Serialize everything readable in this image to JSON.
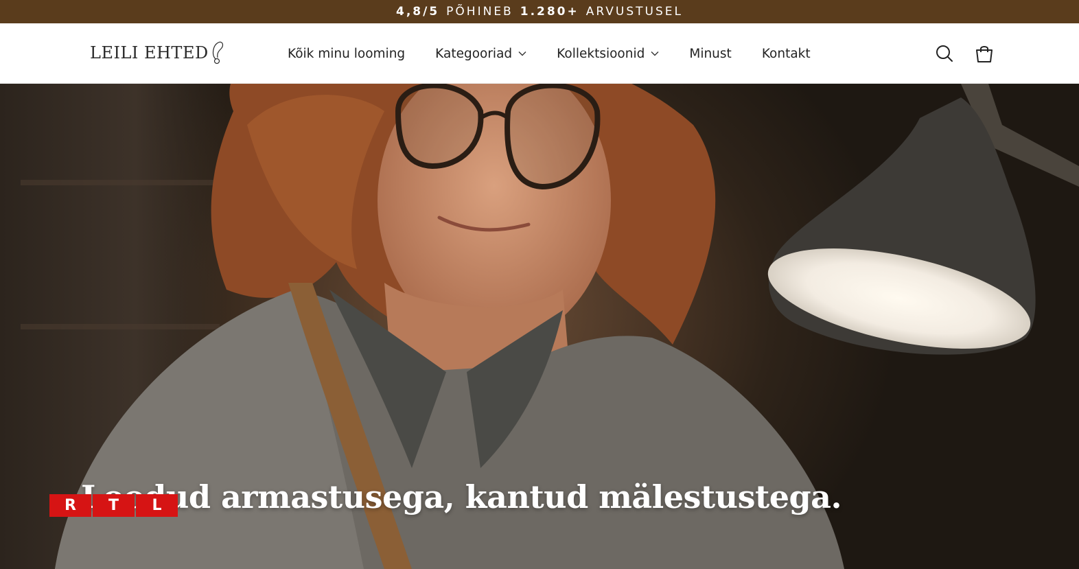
{
  "announcement": {
    "rating": "4,8/5",
    "based_on": "PÕHINEB",
    "count": "1.280+",
    "reviews": "ARVUSTUSEL"
  },
  "header": {
    "logo_text": "LEILI EHTED",
    "nav": [
      {
        "label": "Kõik minu looming",
        "has_dropdown": false
      },
      {
        "label": "Kategooriad",
        "has_dropdown": true
      },
      {
        "label": "Kollektsioonid",
        "has_dropdown": true
      },
      {
        "label": "Minust",
        "has_dropdown": false
      },
      {
        "label": "Kontakt",
        "has_dropdown": false
      }
    ],
    "icons": [
      "search-icon",
      "cart-icon"
    ]
  },
  "hero": {
    "heading": "Loodud armastusega, kantud mälestustega.",
    "image": "woman-with-glasses-at-workbench-with-lamp"
  },
  "watermark": {
    "letters": [
      "R",
      "T",
      "L"
    ],
    "color": "#d61414"
  },
  "colors": {
    "announcement_bg": "#5a3c1c",
    "header_bg": "#ffffff"
  }
}
